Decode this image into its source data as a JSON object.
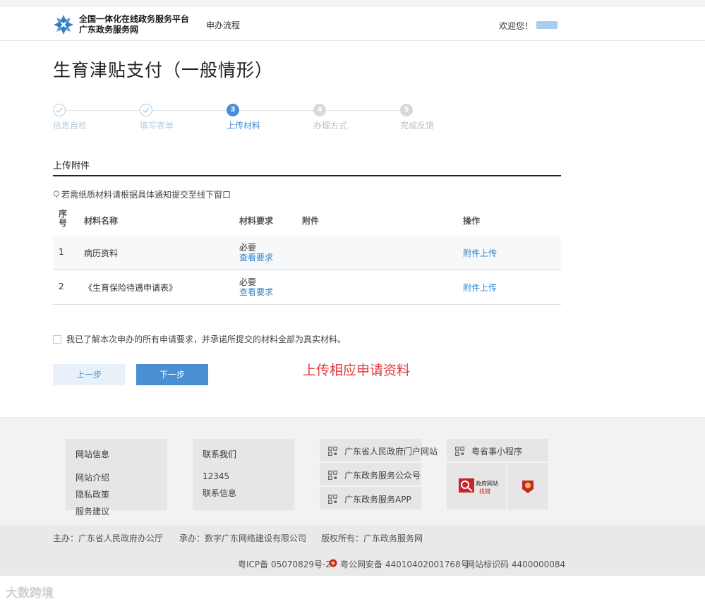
{
  "header": {
    "site_line1": "全国一体化在线政务服务平台",
    "site_line2": "广东政务服务网",
    "nav_process": "申办流程",
    "welcome": "欢迎您！"
  },
  "page": {
    "title": "生育津贴支付（一般情形）"
  },
  "steps": [
    {
      "num": "1",
      "label": "信息自检",
      "state": "done"
    },
    {
      "num": "2",
      "label": "填写表单",
      "state": "done"
    },
    {
      "num": "3",
      "label": "上传材料",
      "state": "active"
    },
    {
      "num": "4",
      "label": "办理方式",
      "state": "todo"
    },
    {
      "num": "5",
      "label": "完成反馈",
      "state": "todo"
    }
  ],
  "upload": {
    "section_title": "上传附件",
    "notice": "若需纸质材料请根据具体通知提交至线下窗口",
    "headers": {
      "seq_line1": "序",
      "seq_line2": "号",
      "name": "材料名称",
      "requirement": "材料要求",
      "attachment": "附件",
      "action": "操作"
    },
    "rows": [
      {
        "seq": "1",
        "name": "病历资料",
        "required": "必要",
        "view_req": "查看要求",
        "action": "附件上传"
      },
      {
        "seq": "2",
        "name": "《生育保险待遇申请表》",
        "required": "必要",
        "view_req": "查看要求",
        "action": "附件上传"
      }
    ]
  },
  "agreement": "我已了解本次申办的所有申请要求，并承诺所提交的材料全部为真实材料。",
  "buttons": {
    "prev": "上一步",
    "next": "下一步"
  },
  "annotation": "上传相应申请资料",
  "footer": {
    "site_info_title": "网站信息",
    "site_info_items": [
      "网站介绍",
      "隐私政策",
      "服务建议"
    ],
    "contact_title": "联系我们",
    "contact_items": [
      "12345",
      "联系信息"
    ],
    "links": [
      "广东省人民政府门户网站",
      "广东政务服务公众号",
      "广东政务服务APP"
    ],
    "mini_program": "粤省事小程序",
    "badge_text_1": "政府网站",
    "badge_text_2": "找错",
    "host": "主办：广东省人民政府办公厅",
    "undertake": "承办：数字广东网络建设有限公司",
    "copyright": "版权所有：广东政务服务网",
    "icp": "粤ICP备 05070829号-2",
    "police": "粤公网安备 44010402001768号",
    "site_id": "网站标识码 4400000084"
  },
  "watermark": "大数跨境",
  "colors": {
    "accent": "#4a8fd3",
    "link": "#2f84d0",
    "annotation": "#e23a3a"
  }
}
